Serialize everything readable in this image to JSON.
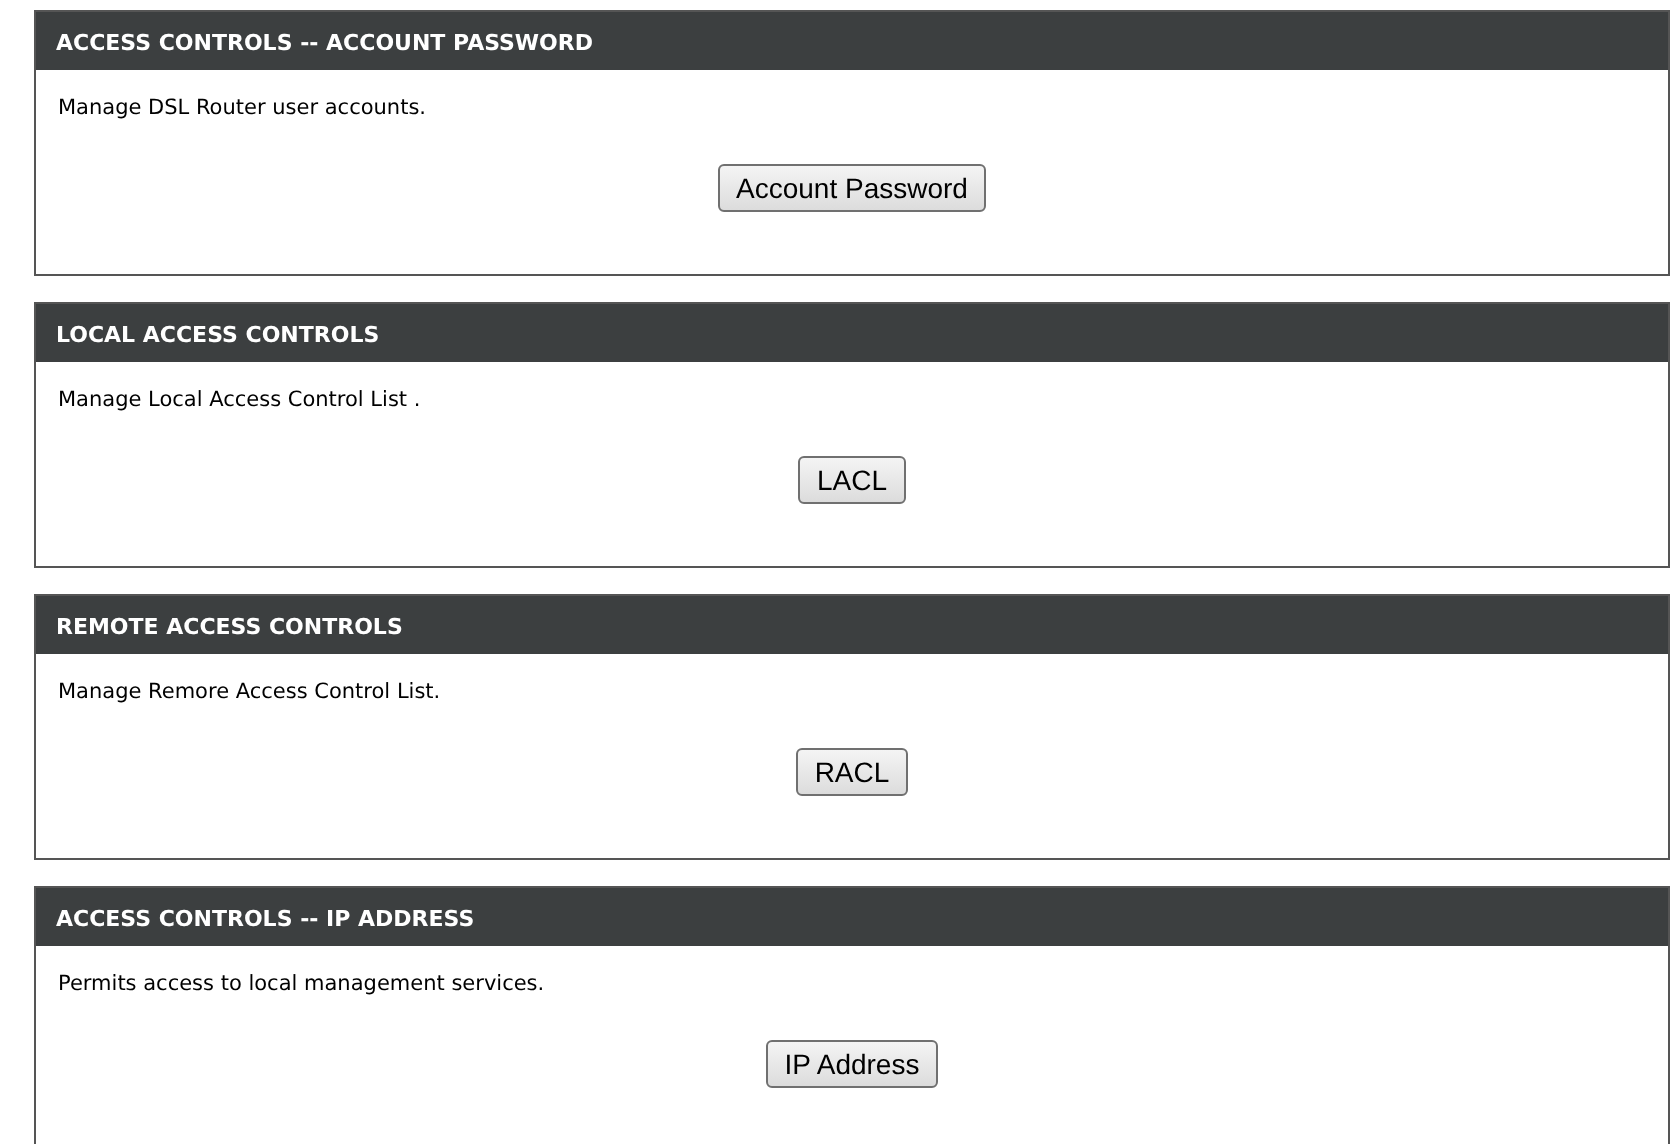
{
  "sections": [
    {
      "title": "ACCESS CONTROLS -- ACCOUNT PASSWORD",
      "description": "Manage DSL Router user accounts.",
      "button": "Account Password"
    },
    {
      "title": "LOCAL ACCESS CONTROLS",
      "description": "Manage Local Access Control List .",
      "button": "LACL"
    },
    {
      "title": "REMOTE ACCESS CONTROLS",
      "description": "Manage Remore Access Control List.",
      "button": "RACL"
    },
    {
      "title": "ACCESS CONTROLS -- IP ADDRESS",
      "description": "Permits access to local management services.",
      "button": "IP Address"
    }
  ]
}
